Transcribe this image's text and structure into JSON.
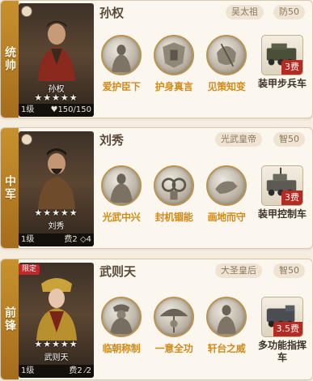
{
  "cards": [
    {
      "role": "统帅",
      "name": "孙权",
      "title_tag": "吴太祖",
      "stat_tag": "防50",
      "stars": "★★★★★",
      "portrait_name": "孙权",
      "level": "1级",
      "bar_right": "♥150/150",
      "limited": "",
      "skills": [
        "爱护臣下",
        "护身真言",
        "见策知变"
      ],
      "equip": {
        "cost": "3费",
        "label": "装甲步兵车"
      }
    },
    {
      "role": "中军",
      "name": "刘秀",
      "title_tag": "光武皇帝",
      "stat_tag": "智50",
      "stars": "★★★★★",
      "portrait_name": "刘秀",
      "level": "1级",
      "bar_right": "费2 ◇4",
      "limited": "",
      "skills": [
        "光武中兴",
        "封机锢能",
        "画地而守"
      ],
      "equip": {
        "cost": "3费",
        "label": "装甲控制车"
      }
    },
    {
      "role": "前锋",
      "name": "武则天",
      "title_tag": "大圣皇后",
      "stat_tag": "智50",
      "stars": "★★★★★",
      "portrait_name": "武则天",
      "level": "1级",
      "bar_right": "费2 ⁄2",
      "limited": "限定",
      "skills": [
        "临朝称制",
        "一意全功",
        "轩台之威"
      ],
      "equip": {
        "cost": "3.5费",
        "label": "多功能指挥车"
      }
    }
  ],
  "colors": {
    "role_strip": "#b67b22",
    "skill_label": "#d18b1a",
    "cost_badge": "#b52a22",
    "limited_badge": "#c0262c"
  }
}
